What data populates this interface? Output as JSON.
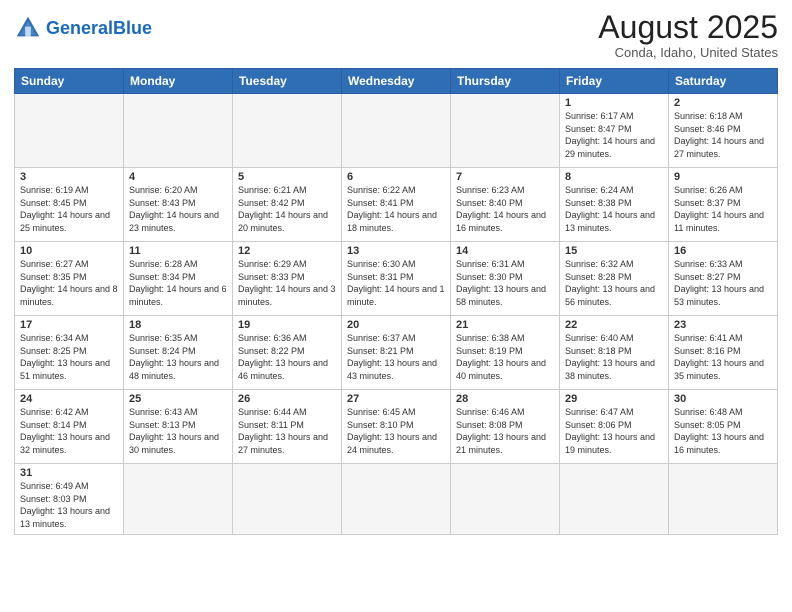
{
  "header": {
    "logo_general": "General",
    "logo_blue": "Blue",
    "month_title": "August 2025",
    "location": "Conda, Idaho, United States"
  },
  "weekdays": [
    "Sunday",
    "Monday",
    "Tuesday",
    "Wednesday",
    "Thursday",
    "Friday",
    "Saturday"
  ],
  "weeks": [
    [
      {
        "day": "",
        "info": ""
      },
      {
        "day": "",
        "info": ""
      },
      {
        "day": "",
        "info": ""
      },
      {
        "day": "",
        "info": ""
      },
      {
        "day": "",
        "info": ""
      },
      {
        "day": "1",
        "info": "Sunrise: 6:17 AM\nSunset: 8:47 PM\nDaylight: 14 hours and 29 minutes."
      },
      {
        "day": "2",
        "info": "Sunrise: 6:18 AM\nSunset: 8:46 PM\nDaylight: 14 hours and 27 minutes."
      }
    ],
    [
      {
        "day": "3",
        "info": "Sunrise: 6:19 AM\nSunset: 8:45 PM\nDaylight: 14 hours and 25 minutes."
      },
      {
        "day": "4",
        "info": "Sunrise: 6:20 AM\nSunset: 8:43 PM\nDaylight: 14 hours and 23 minutes."
      },
      {
        "day": "5",
        "info": "Sunrise: 6:21 AM\nSunset: 8:42 PM\nDaylight: 14 hours and 20 minutes."
      },
      {
        "day": "6",
        "info": "Sunrise: 6:22 AM\nSunset: 8:41 PM\nDaylight: 14 hours and 18 minutes."
      },
      {
        "day": "7",
        "info": "Sunrise: 6:23 AM\nSunset: 8:40 PM\nDaylight: 14 hours and 16 minutes."
      },
      {
        "day": "8",
        "info": "Sunrise: 6:24 AM\nSunset: 8:38 PM\nDaylight: 14 hours and 13 minutes."
      },
      {
        "day": "9",
        "info": "Sunrise: 6:26 AM\nSunset: 8:37 PM\nDaylight: 14 hours and 11 minutes."
      }
    ],
    [
      {
        "day": "10",
        "info": "Sunrise: 6:27 AM\nSunset: 8:35 PM\nDaylight: 14 hours and 8 minutes."
      },
      {
        "day": "11",
        "info": "Sunrise: 6:28 AM\nSunset: 8:34 PM\nDaylight: 14 hours and 6 minutes."
      },
      {
        "day": "12",
        "info": "Sunrise: 6:29 AM\nSunset: 8:33 PM\nDaylight: 14 hours and 3 minutes."
      },
      {
        "day": "13",
        "info": "Sunrise: 6:30 AM\nSunset: 8:31 PM\nDaylight: 14 hours and 1 minute."
      },
      {
        "day": "14",
        "info": "Sunrise: 6:31 AM\nSunset: 8:30 PM\nDaylight: 13 hours and 58 minutes."
      },
      {
        "day": "15",
        "info": "Sunrise: 6:32 AM\nSunset: 8:28 PM\nDaylight: 13 hours and 56 minutes."
      },
      {
        "day": "16",
        "info": "Sunrise: 6:33 AM\nSunset: 8:27 PM\nDaylight: 13 hours and 53 minutes."
      }
    ],
    [
      {
        "day": "17",
        "info": "Sunrise: 6:34 AM\nSunset: 8:25 PM\nDaylight: 13 hours and 51 minutes."
      },
      {
        "day": "18",
        "info": "Sunrise: 6:35 AM\nSunset: 8:24 PM\nDaylight: 13 hours and 48 minutes."
      },
      {
        "day": "19",
        "info": "Sunrise: 6:36 AM\nSunset: 8:22 PM\nDaylight: 13 hours and 46 minutes."
      },
      {
        "day": "20",
        "info": "Sunrise: 6:37 AM\nSunset: 8:21 PM\nDaylight: 13 hours and 43 minutes."
      },
      {
        "day": "21",
        "info": "Sunrise: 6:38 AM\nSunset: 8:19 PM\nDaylight: 13 hours and 40 minutes."
      },
      {
        "day": "22",
        "info": "Sunrise: 6:40 AM\nSunset: 8:18 PM\nDaylight: 13 hours and 38 minutes."
      },
      {
        "day": "23",
        "info": "Sunrise: 6:41 AM\nSunset: 8:16 PM\nDaylight: 13 hours and 35 minutes."
      }
    ],
    [
      {
        "day": "24",
        "info": "Sunrise: 6:42 AM\nSunset: 8:14 PM\nDaylight: 13 hours and 32 minutes."
      },
      {
        "day": "25",
        "info": "Sunrise: 6:43 AM\nSunset: 8:13 PM\nDaylight: 13 hours and 30 minutes."
      },
      {
        "day": "26",
        "info": "Sunrise: 6:44 AM\nSunset: 8:11 PM\nDaylight: 13 hours and 27 minutes."
      },
      {
        "day": "27",
        "info": "Sunrise: 6:45 AM\nSunset: 8:10 PM\nDaylight: 13 hours and 24 minutes."
      },
      {
        "day": "28",
        "info": "Sunrise: 6:46 AM\nSunset: 8:08 PM\nDaylight: 13 hours and 21 minutes."
      },
      {
        "day": "29",
        "info": "Sunrise: 6:47 AM\nSunset: 8:06 PM\nDaylight: 13 hours and 19 minutes."
      },
      {
        "day": "30",
        "info": "Sunrise: 6:48 AM\nSunset: 8:05 PM\nDaylight: 13 hours and 16 minutes."
      }
    ],
    [
      {
        "day": "31",
        "info": "Sunrise: 6:49 AM\nSunset: 8:03 PM\nDaylight: 13 hours and 13 minutes."
      },
      {
        "day": "",
        "info": ""
      },
      {
        "day": "",
        "info": ""
      },
      {
        "day": "",
        "info": ""
      },
      {
        "day": "",
        "info": ""
      },
      {
        "day": "",
        "info": ""
      },
      {
        "day": "",
        "info": ""
      }
    ]
  ]
}
